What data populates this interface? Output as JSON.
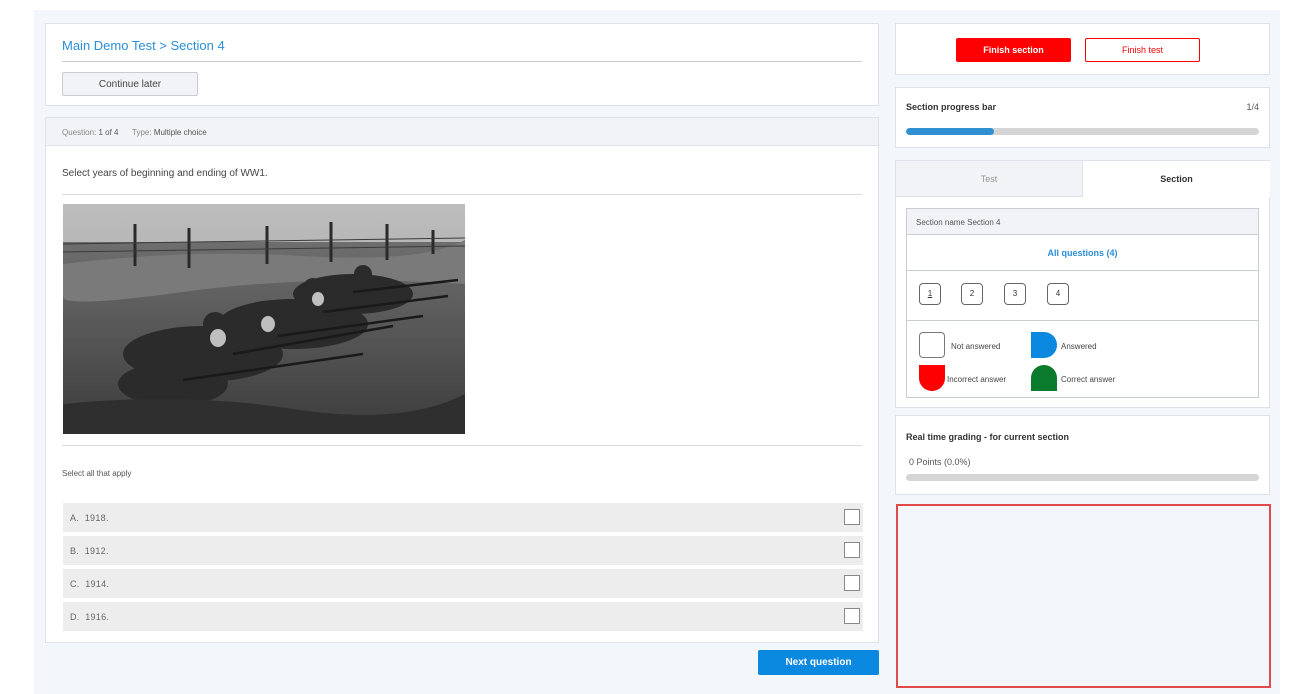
{
  "header": {
    "breadcrumb": "Main Demo Test > Section 4",
    "continue_label": "Continue later"
  },
  "question_bar": {
    "question_label": "Question:",
    "question_value": "1 of 4",
    "type_label": "Type:",
    "type_value": "Multiple choice"
  },
  "question": {
    "text": "Select years of beginning and ending of WW1.",
    "image_semantic": "ww1-soldiers-trench-photo",
    "instruction": "Select all that apply",
    "options": [
      {
        "letter": "A.",
        "text": "1918.",
        "checked": false
      },
      {
        "letter": "B.",
        "text": "1912.",
        "checked": false
      },
      {
        "letter": "C.",
        "text": "1914.",
        "checked": false
      },
      {
        "letter": "D.",
        "text": "1916.",
        "checked": false
      }
    ]
  },
  "footer": {
    "next_label": "Next question"
  },
  "actions": {
    "finish_section_label": "Finish section",
    "finish_test_label": "Finish test"
  },
  "progress": {
    "title": "Section progress bar",
    "count": "1/4",
    "fraction": 0.25
  },
  "navigator": {
    "tabs": [
      "Test",
      "Section"
    ],
    "active_tab": "Section",
    "section_name": "Section name Section 4",
    "all_questions": "All questions (4)",
    "question_numbers": [
      "1",
      "2",
      "3",
      "4"
    ],
    "current_question": "1",
    "legend": [
      {
        "label": "Not answered",
        "color": "#ffffff"
      },
      {
        "label": "Answered",
        "color": "#0b88df"
      },
      {
        "label": "Incorrect answer",
        "color": "#ff0000"
      },
      {
        "label": "Correct answer",
        "color": "#0a7a2c"
      }
    ]
  },
  "grading": {
    "title": "Real time grading - for current section",
    "points": "0 Points (0.0%)",
    "fraction": 0
  },
  "colors": {
    "accent": "#0b88df",
    "danger": "#ff0000",
    "success": "#0a7a2c",
    "highlight_border": "#e04a4a"
  }
}
